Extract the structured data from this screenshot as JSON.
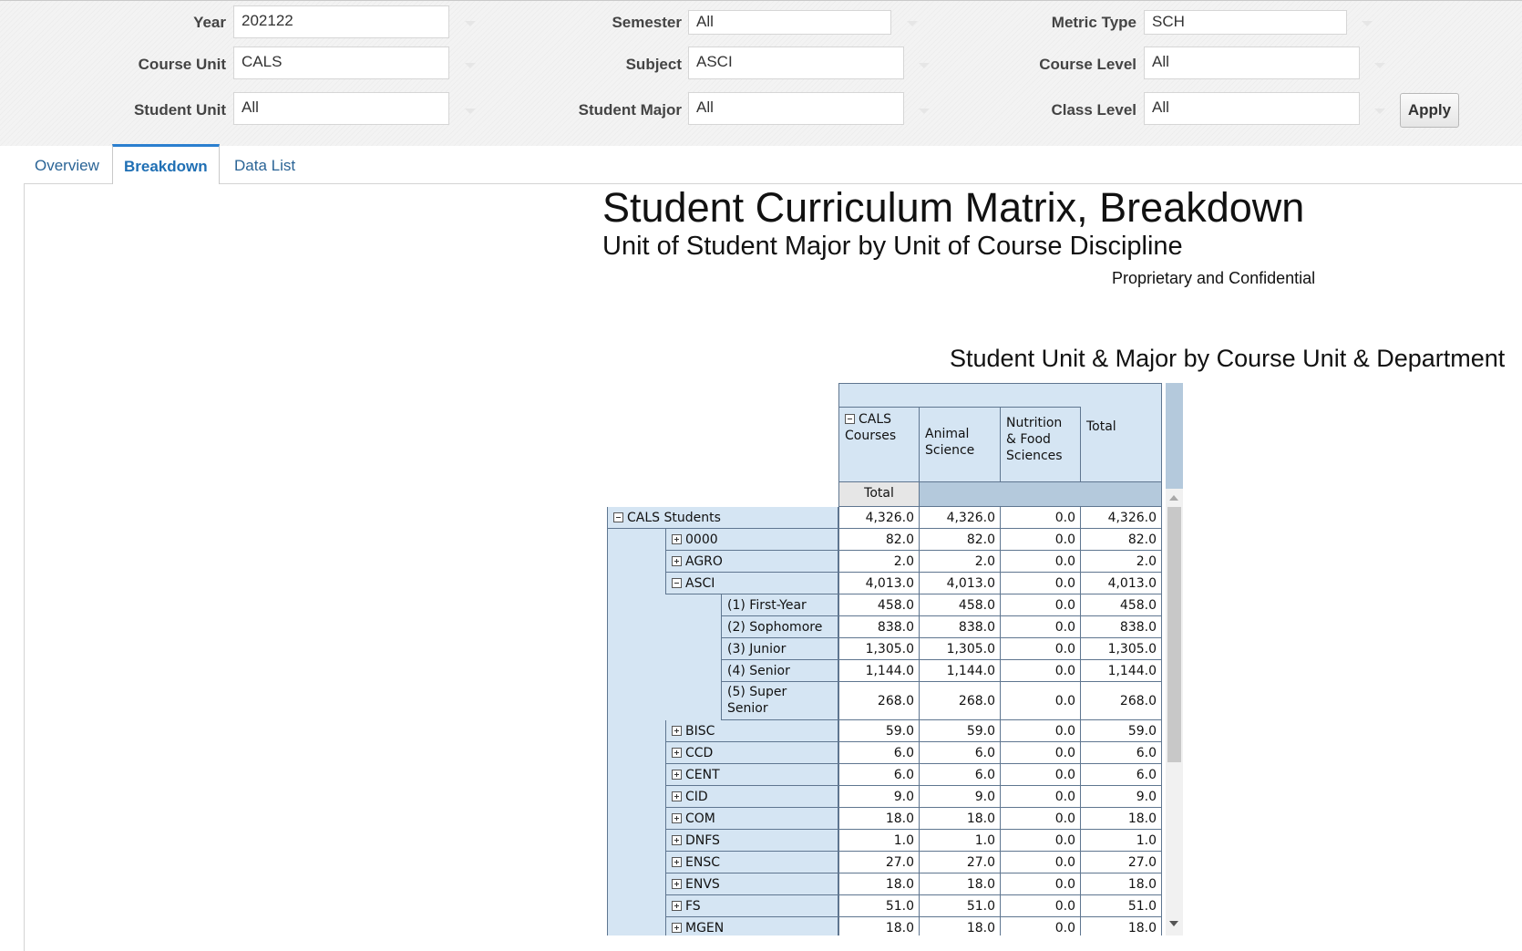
{
  "prompts": {
    "year": {
      "label": "Year",
      "value": "202122"
    },
    "semester": {
      "label": "Semester",
      "value": "All"
    },
    "metric_type": {
      "label": "Metric Type",
      "value": "SCH"
    },
    "course_unit": {
      "label": "Course Unit",
      "value": "CALS"
    },
    "subject": {
      "label": "Subject",
      "value": "ASCI"
    },
    "course_level": {
      "label": "Course Level",
      "value": "All"
    },
    "student_unit": {
      "label": "Student Unit",
      "value": "All"
    },
    "student_major": {
      "label": "Student Major",
      "value": "All"
    },
    "class_level": {
      "label": "Class Level",
      "value": "All"
    },
    "apply_label": "Apply"
  },
  "tabs": [
    {
      "label": "Overview",
      "active": false
    },
    {
      "label": "Breakdown",
      "active": true
    },
    {
      "label": "Data List",
      "active": false
    }
  ],
  "report": {
    "title": "Student Curriculum Matrix, Breakdown",
    "subtitle": "Unit of Student Major by Unit of Course Discipline",
    "confidential": "Proprietary and Confidential",
    "table_title": "Student Unit & Major by Course Unit & Department"
  },
  "pivot": {
    "col_group": "CALS Courses",
    "columns": [
      "Animal Science",
      "Nutrition & Food Sciences",
      "Total"
    ],
    "measure_label": "Total",
    "rows": [
      {
        "label": "CALS Students",
        "level": 0,
        "toggle": "minus",
        "values": [
          "4,326.0",
          "4,326.0",
          "0.0",
          "4,326.0"
        ]
      },
      {
        "label": "0000",
        "level": 1,
        "toggle": "plus",
        "values": [
          "82.0",
          "82.0",
          "0.0",
          "82.0"
        ]
      },
      {
        "label": "AGRO",
        "level": 1,
        "toggle": "plus",
        "values": [
          "2.0",
          "2.0",
          "0.0",
          "2.0"
        ]
      },
      {
        "label": "ASCI",
        "level": 1,
        "toggle": "minus",
        "values": [
          "4,013.0",
          "4,013.0",
          "0.0",
          "4,013.0"
        ]
      },
      {
        "label": "(1) First-Year",
        "level": 2,
        "toggle": "",
        "values": [
          "458.0",
          "458.0",
          "0.0",
          "458.0"
        ]
      },
      {
        "label": "(2) Sophomore",
        "level": 2,
        "toggle": "",
        "values": [
          "838.0",
          "838.0",
          "0.0",
          "838.0"
        ]
      },
      {
        "label": "(3) Junior",
        "level": 2,
        "toggle": "",
        "values": [
          "1,305.0",
          "1,305.0",
          "0.0",
          "1,305.0"
        ]
      },
      {
        "label": "(4) Senior",
        "level": 2,
        "toggle": "",
        "values": [
          "1,144.0",
          "1,144.0",
          "0.0",
          "1,144.0"
        ]
      },
      {
        "label": "(5) Super Senior",
        "level": 2,
        "toggle": "",
        "tall": true,
        "values": [
          "268.0",
          "268.0",
          "0.0",
          "268.0"
        ]
      },
      {
        "label": "BISC",
        "level": 1,
        "toggle": "plus",
        "values": [
          "59.0",
          "59.0",
          "0.0",
          "59.0"
        ]
      },
      {
        "label": "CCD",
        "level": 1,
        "toggle": "plus",
        "values": [
          "6.0",
          "6.0",
          "0.0",
          "6.0"
        ]
      },
      {
        "label": "CENT",
        "level": 1,
        "toggle": "plus",
        "values": [
          "6.0",
          "6.0",
          "0.0",
          "6.0"
        ]
      },
      {
        "label": "CID",
        "level": 1,
        "toggle": "plus",
        "values": [
          "9.0",
          "9.0",
          "0.0",
          "9.0"
        ]
      },
      {
        "label": "COM",
        "level": 1,
        "toggle": "plus",
        "values": [
          "18.0",
          "18.0",
          "0.0",
          "18.0"
        ]
      },
      {
        "label": "DNFS",
        "level": 1,
        "toggle": "plus",
        "values": [
          "1.0",
          "1.0",
          "0.0",
          "1.0"
        ]
      },
      {
        "label": "ENSC",
        "level": 1,
        "toggle": "plus",
        "values": [
          "27.0",
          "27.0",
          "0.0",
          "27.0"
        ]
      },
      {
        "label": "ENVS",
        "level": 1,
        "toggle": "plus",
        "values": [
          "18.0",
          "18.0",
          "0.0",
          "18.0"
        ]
      },
      {
        "label": "FS",
        "level": 1,
        "toggle": "plus",
        "values": [
          "51.0",
          "51.0",
          "0.0",
          "51.0"
        ]
      },
      {
        "label": "MGEN",
        "level": 1,
        "toggle": "plus",
        "values": [
          "18.0",
          "18.0",
          "0.0",
          "18.0"
        ]
      }
    ]
  }
}
